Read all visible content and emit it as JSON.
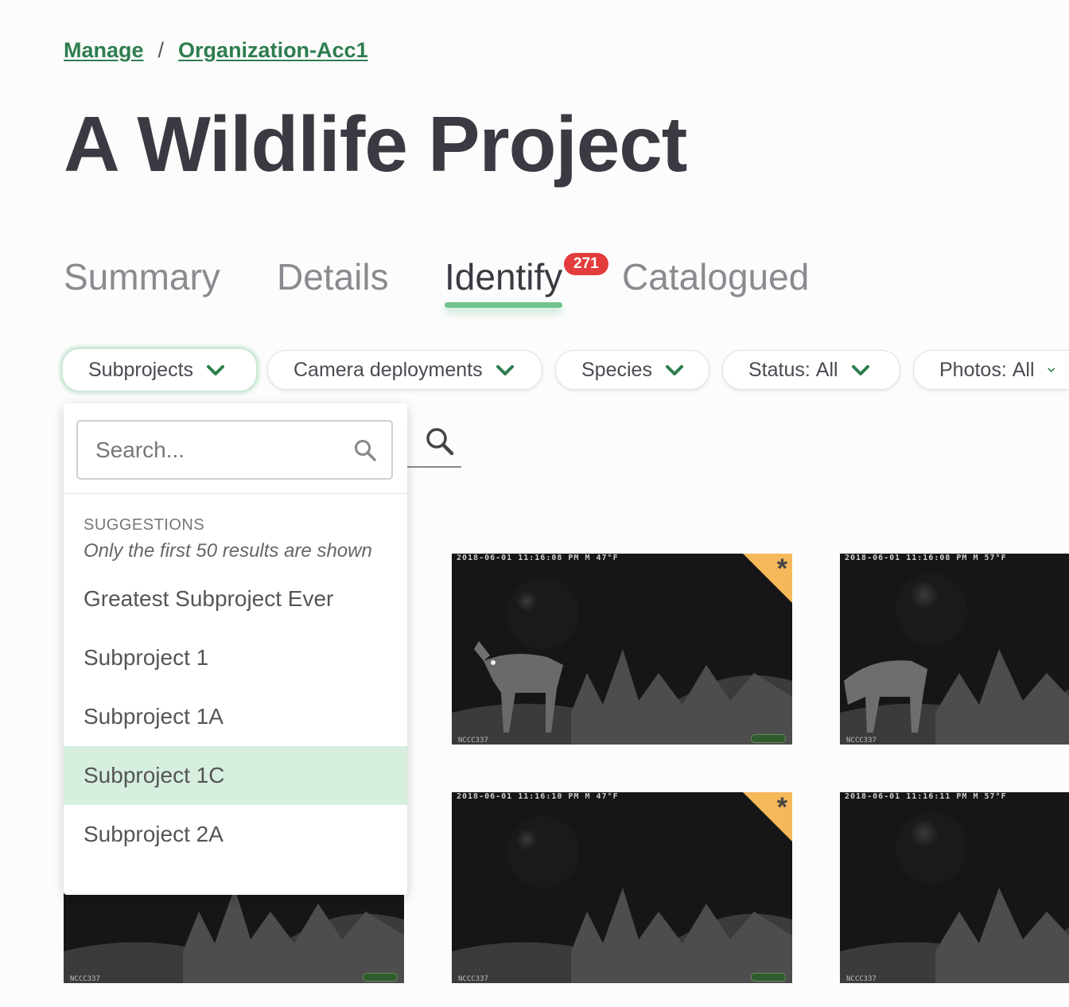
{
  "breadcrumb": {
    "items": [
      {
        "label": "Manage"
      },
      {
        "label": "Organization-Acc1"
      }
    ],
    "separator": "/"
  },
  "page": {
    "title": "A Wildlife Project"
  },
  "tabs": [
    {
      "label": "Summary"
    },
    {
      "label": "Details"
    },
    {
      "label": "Identify",
      "active": true,
      "badge": "271"
    },
    {
      "label": "Catalogued"
    }
  ],
  "filters": {
    "subprojects": "Subprojects",
    "camera_deployments": "Camera deployments",
    "species": "Species",
    "status_label": "Status:",
    "status_value": "All",
    "photos_label": "Photos:",
    "photos_value": "All"
  },
  "dropdown": {
    "search_placeholder": "Search...",
    "heading": "SUGGESTIONS",
    "note": "Only the first 50 results are shown",
    "items": [
      {
        "label": "Greatest Subproject Ever"
      },
      {
        "label": "Subproject 1"
      },
      {
        "label": "Subproject 1A"
      },
      {
        "label": "Subproject 1C",
        "selected": true
      },
      {
        "label": "Subproject 2A"
      }
    ]
  },
  "thumbnails": [
    {
      "header": "2018-06-01 11:16:08 PM  M 47°F",
      "footer": "NCCC337",
      "flagged": true,
      "has_deer": true
    },
    {
      "header": "2018-06-01 11:16:08 PM  M 57°F",
      "footer": "NCCC337",
      "flagged": false,
      "has_deer": true
    },
    {
      "header": "",
      "footer": "NCCC337",
      "flagged": false,
      "has_deer": false
    },
    {
      "header": "2018-06-01 11:16:10 PM  M 47°F",
      "footer": "NCCC337",
      "flagged": true,
      "has_deer": false
    },
    {
      "header": "2018-06-01 11:16:11 PM  M 57°F",
      "footer": "NCCC337",
      "flagged": false,
      "has_deer": false
    }
  ],
  "colors": {
    "accent": "#2e7d4f",
    "tab_underline": "#6fc48c",
    "badge": "#e23c3c",
    "selected_item": "#d6efdf",
    "flag_corner": "#f5b85a"
  },
  "icons": {
    "chevron": "chevron-down-icon",
    "search": "search-icon",
    "flag": "asterisk-icon"
  }
}
